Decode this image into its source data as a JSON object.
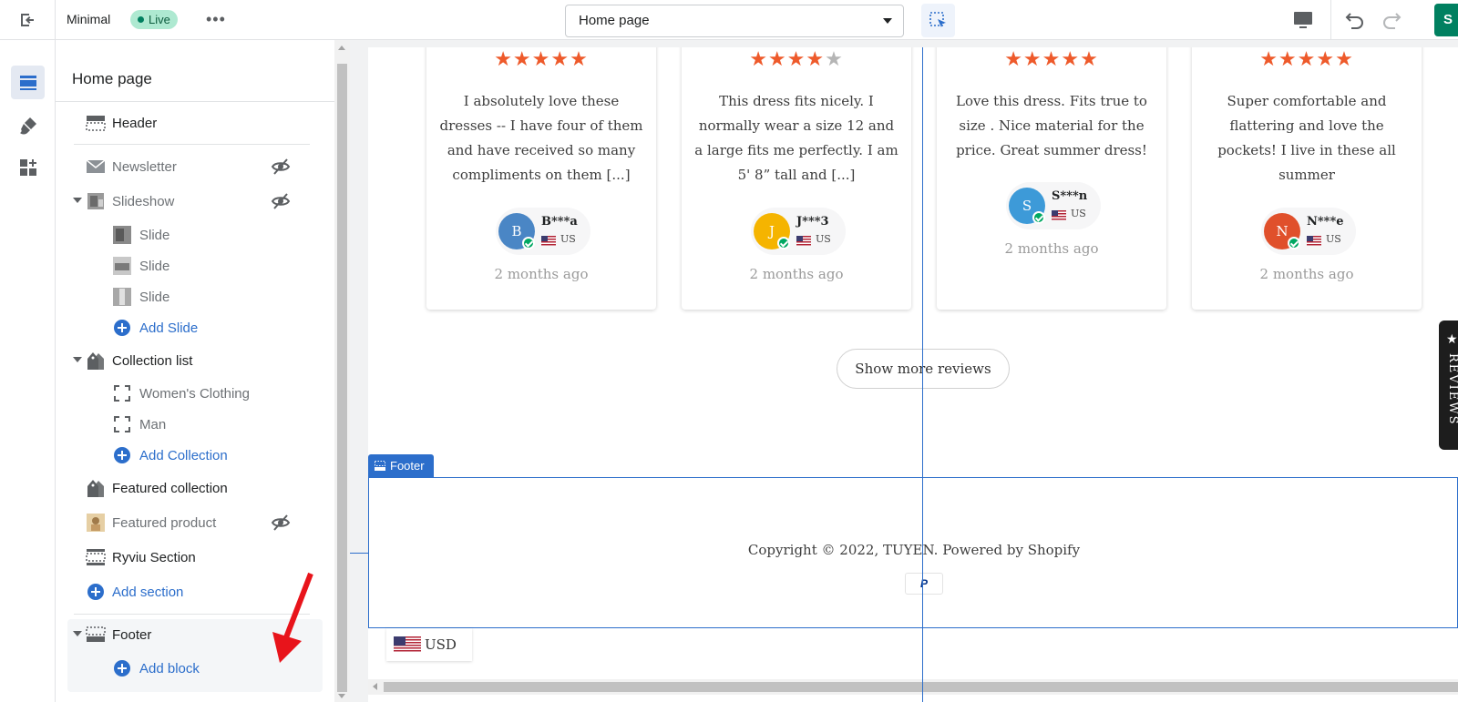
{
  "topbar": {
    "theme_name": "Minimal",
    "status_badge": "Live",
    "more_label": "•••",
    "page_select": "Home page",
    "save_label": "S"
  },
  "panel": {
    "title": "Home page",
    "items": [
      {
        "label": "Header"
      },
      {
        "label": "Newsletter"
      },
      {
        "label": "Slideshow"
      },
      {
        "label": "Slide"
      },
      {
        "label": "Slide"
      },
      {
        "label": "Slide"
      },
      {
        "label": "Add Slide"
      },
      {
        "label": "Collection list"
      },
      {
        "label": "Women's Clothing"
      },
      {
        "label": "Man"
      },
      {
        "label": "Add Collection"
      },
      {
        "label": "Featured collection"
      },
      {
        "label": "Featured product"
      },
      {
        "label": "Ryviu Section"
      },
      {
        "label": "Add section"
      },
      {
        "label": "Footer"
      },
      {
        "label": "Add block"
      }
    ]
  },
  "reviews": [
    {
      "stars": 5,
      "text": "I absolutely love these dresses -- I have four of them and have received so many compliments on them [...]",
      "initial": "B",
      "name": "B***a",
      "country": "US",
      "date": "2 months ago",
      "avatar_color": "#4a86c5"
    },
    {
      "stars": 4,
      "text": "This dress fits nicely. I normally wear a size 12 and a large fits me perfectly. I am 5' 8” tall and [...]",
      "initial": "J",
      "name": "J***3",
      "country": "US",
      "date": "2 months ago",
      "avatar_color": "#f5b400"
    },
    {
      "stars": 5,
      "text": "Love this dress. Fits true to size . Nice material for the price. Great summer dress!",
      "initial": "S",
      "name": "S***n",
      "country": "US",
      "date": "2 months ago",
      "avatar_color": "#3d9ad8"
    },
    {
      "stars": 5,
      "text": "Super comfortable and flattering and love the pockets! I live in these all summer",
      "initial": "N",
      "name": "N***e",
      "country": "US",
      "date": "2 months ago",
      "avatar_color": "#e0502b"
    }
  ],
  "show_more_label": "Show more reviews",
  "footer": {
    "tag_label": "Footer",
    "copyright": "Copyright © 2022, TUYEN. Powered by Shopify",
    "payment_icon": "P",
    "currency": "USD"
  },
  "reviews_tab_label": "REVIEWS",
  "colors": {
    "accent": "#2c6ecb",
    "star": "#ee5a2b",
    "save": "#008060",
    "live_badge": "#aee9d1"
  }
}
